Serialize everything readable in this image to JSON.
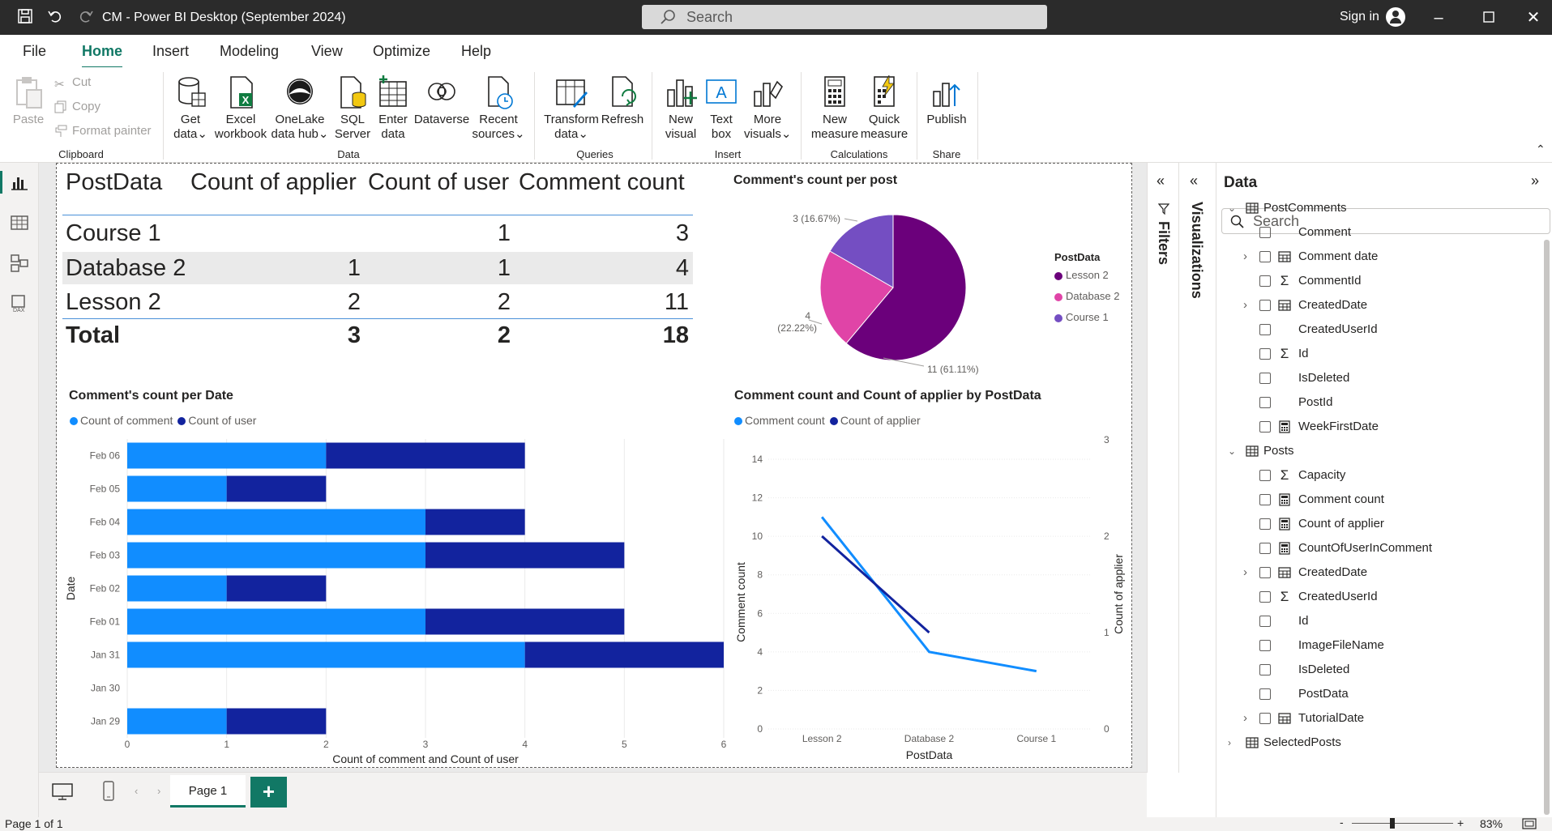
{
  "window": {
    "title": "CM - Power BI Desktop (September 2024)",
    "search_placeholder": "Search",
    "sign_in": "Sign in"
  },
  "menu": [
    "File",
    "Home",
    "Insert",
    "Modeling",
    "View",
    "Optimize",
    "Help"
  ],
  "ribbon": {
    "clipboard": {
      "paste": "Paste",
      "cut": "Cut",
      "copy": "Copy",
      "format_painter": "Format painter",
      "group": "Clipboard"
    },
    "data": {
      "get_data_1": "Get",
      "get_data_2": "data",
      "excel_1": "Excel",
      "excel_2": "workbook",
      "onelake_1": "OneLake",
      "onelake_2": "data hub",
      "sql_1": "SQL",
      "sql_2": "Server",
      "enter_1": "Enter",
      "enter_2": "data",
      "dataverse": "Dataverse",
      "recent_1": "Recent",
      "recent_2": "sources",
      "group": "Data"
    },
    "queries": {
      "transform_1": "Transform",
      "transform_2": "data",
      "refresh": "Refresh",
      "group": "Queries"
    },
    "insert": {
      "new_visual_1": "New",
      "new_visual_2": "visual",
      "text_box_1": "Text",
      "text_box_2": "box",
      "more_visuals_1": "More",
      "more_visuals_2": "visuals",
      "group": "Insert"
    },
    "calculations": {
      "new_measure_1": "New",
      "new_measure_2": "measure",
      "quick_measure_1": "Quick",
      "quick_measure_2": "measure",
      "group": "Calculations"
    },
    "share": {
      "publish": "Publish",
      "group": "Share"
    }
  },
  "table": {
    "headers": [
      "PostData",
      "Count of applier",
      "Count of user",
      "Comment count"
    ],
    "rows": [
      {
        "name": "Course 1",
        "applier": "",
        "user": "1",
        "comment": "3"
      },
      {
        "name": "Database 2",
        "applier": "1",
        "user": "1",
        "comment": "4"
      },
      {
        "name": "Lesson 2",
        "applier": "2",
        "user": "2",
        "comment": "11"
      }
    ],
    "total": {
      "name": "Total",
      "applier": "3",
      "user": "2",
      "comment": "18"
    }
  },
  "chart_data": [
    {
      "type": "pie",
      "title": "Comment's count per post",
      "legend_title": "PostData",
      "legend_position": "right",
      "slices": [
        {
          "name": "Lesson 2",
          "value": 11,
          "label": "11 (61.11%)",
          "color": "#6b007b"
        },
        {
          "name": "Database 2",
          "value": 4,
          "label": "4 (22.22%)",
          "color": "#e044a7"
        },
        {
          "name": "Course 1",
          "value": 3,
          "label": "3 (16.67%)",
          "color": "#744ec2"
        }
      ]
    },
    {
      "type": "bar",
      "orientation": "horizontal",
      "stacked": true,
      "title": "Comment's count per Date",
      "xlabel": "Count of comment and Count of user",
      "ylabel": "Date",
      "xlim": [
        0,
        6
      ],
      "xticks": [
        "0",
        "1",
        "2",
        "3",
        "4",
        "5",
        "6"
      ],
      "legend_position": "top-left",
      "categories": [
        "Feb 06",
        "Feb 05",
        "Feb 04",
        "Feb 03",
        "Feb 02",
        "Feb 01",
        "Jan 31",
        "Jan 30",
        "Jan 29"
      ],
      "series": [
        {
          "name": "Count of comment",
          "color": "#118dff",
          "values": [
            2,
            1,
            3,
            3,
            1,
            3,
            4,
            0,
            1
          ]
        },
        {
          "name": "Count of user",
          "color": "#12239e",
          "values": [
            2,
            1,
            1,
            2,
            1,
            2,
            2,
            0,
            1
          ]
        }
      ]
    },
    {
      "type": "line",
      "title": "Comment count and Count of applier by PostData",
      "xlabel": "PostData",
      "ylabel": "Comment count",
      "y2label": "Count of applier",
      "categories": [
        "Lesson 2",
        "Database 2",
        "Course 1"
      ],
      "ylim": [
        0,
        14
      ],
      "yticks": [
        "0",
        "2",
        "4",
        "6",
        "8",
        "10",
        "12",
        "14"
      ],
      "y2lim": [
        0,
        3
      ],
      "y2ticks": [
        "0",
        "1",
        "2",
        "3"
      ],
      "legend_position": "top-left",
      "series": [
        {
          "name": "Comment count",
          "axis": "left",
          "color": "#118dff",
          "values": [
            11,
            4,
            3
          ]
        },
        {
          "name": "Count of applier",
          "axis": "right",
          "color": "#12239e",
          "values": [
            2,
            1,
            null
          ]
        }
      ]
    }
  ],
  "panes": {
    "filters": "Filters",
    "visualizations": "Visualizations",
    "data_title": "Data",
    "data_search": "Search"
  },
  "data_tree": [
    {
      "label": "PostComments",
      "type": "table",
      "level": 0,
      "expanded": true
    },
    {
      "label": "Comment",
      "type": "text",
      "level": 1
    },
    {
      "label": "Comment date",
      "type": "date",
      "level": 1,
      "expandable": true
    },
    {
      "label": "CommentId",
      "type": "sigma",
      "level": 1
    },
    {
      "label": "CreatedDate",
      "type": "date",
      "level": 1,
      "expandable": true
    },
    {
      "label": "CreatedUserId",
      "type": "text",
      "level": 1
    },
    {
      "label": "Id",
      "type": "sigma",
      "level": 1
    },
    {
      "label": "IsDeleted",
      "type": "text",
      "level": 1
    },
    {
      "label": "PostId",
      "type": "text",
      "level": 1
    },
    {
      "label": "WeekFirstDate",
      "type": "measure",
      "level": 1
    },
    {
      "label": "Posts",
      "type": "table",
      "level": 0,
      "expanded": true
    },
    {
      "label": "Capacity",
      "type": "sigma",
      "level": 1
    },
    {
      "label": "Comment count",
      "type": "measure",
      "level": 1
    },
    {
      "label": "Count of applier",
      "type": "measure",
      "level": 1
    },
    {
      "label": "CountOfUserInComment",
      "type": "measure",
      "level": 1
    },
    {
      "label": "CreatedDate",
      "type": "date",
      "level": 1,
      "expandable": true
    },
    {
      "label": "CreatedUserId",
      "type": "sigma",
      "level": 1
    },
    {
      "label": "Id",
      "type": "text",
      "level": 1
    },
    {
      "label": "ImageFileName",
      "type": "text",
      "level": 1
    },
    {
      "label": "IsDeleted",
      "type": "text",
      "level": 1
    },
    {
      "label": "PostData",
      "type": "text",
      "level": 1
    },
    {
      "label": "TutorialDate",
      "type": "date",
      "level": 1,
      "expandable": true
    },
    {
      "label": "SelectedPosts",
      "type": "table",
      "level": 0,
      "expanded": false
    }
  ],
  "pages": {
    "current": "Page 1",
    "add": "+"
  },
  "status": {
    "page_info": "Page 1 of 1",
    "zoom": "83%",
    "zoom_minus": "-",
    "zoom_plus": "+"
  }
}
